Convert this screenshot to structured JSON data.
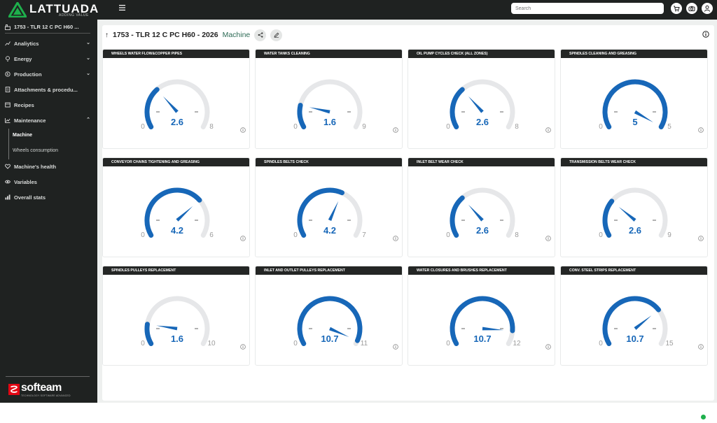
{
  "brand": {
    "name": "LATTUADA",
    "tagline": "ADDING VALUE",
    "accent_color": "#1eb04c"
  },
  "topbar": {
    "menu_icon": "hamburger-icon",
    "search_placeholder": "Search",
    "buttons": [
      {
        "name": "cart-icon"
      },
      {
        "name": "camera-icon"
      },
      {
        "name": "user-icon"
      }
    ]
  },
  "sidebar": {
    "machine": "1753 - TLR 12 C PC H60 ...",
    "items": [
      {
        "label": "Analiytics",
        "icon": "chart-icon",
        "chevron": "down"
      },
      {
        "label": "Energy",
        "icon": "bulb-icon",
        "chevron": "down"
      },
      {
        "label": "Production",
        "icon": "production-icon",
        "chevron": "down"
      },
      {
        "label": "Attachments & procedu...",
        "icon": "document-icon",
        "chevron": ""
      },
      {
        "label": "Recipes",
        "icon": "recipes-icon",
        "chevron": ""
      },
      {
        "label": "Maintenance",
        "icon": "maintenance-icon",
        "chevron": "up"
      },
      {
        "label": "Machine's health",
        "icon": "heart-icon",
        "chevron": ""
      },
      {
        "label": "Variables",
        "icon": "eye-icon",
        "chevron": ""
      },
      {
        "label": "Overall stats",
        "icon": "stats-icon",
        "chevron": ""
      }
    ],
    "sub_items": [
      {
        "label": "Machine",
        "active": true
      },
      {
        "label": "Wheels consumption",
        "active": false
      }
    ],
    "footer": {
      "name": "softeam",
      "tagline": "TECHNOLOGY SOFTWARE ADVANCED"
    }
  },
  "header": {
    "title": "1753 - TLR 12 C PC H60 - 2026",
    "subtitle": "Machine"
  },
  "gauge_color": "#1767b8",
  "gauges": [
    {
      "title": "WHEELS WATER FLOW&COPPER PIPES",
      "value": 2.6,
      "value_label": "2.6",
      "min_label": "0",
      "max": 8,
      "max_label": "8"
    },
    {
      "title": "WATER TANKS CLEANING",
      "value": 1.6,
      "value_label": "1.6",
      "min_label": "0",
      "max": 9,
      "max_label": "9"
    },
    {
      "title": "OIL PUMP CYCLES CHECK (ALL ZONES)",
      "value": 2.6,
      "value_label": "2.6",
      "min_label": "0",
      "max": 8,
      "max_label": "8"
    },
    {
      "title": "SPINDLES CLEANING AND GREASING",
      "value": 5,
      "value_label": "5",
      "min_label": "0",
      "max": 5,
      "max_label": "5"
    },
    {
      "title": "CONVEYOR CHAINS TIGHTENING AND GREASING",
      "value": 4.2,
      "value_label": "4.2",
      "min_label": "0",
      "max": 6,
      "max_label": "6"
    },
    {
      "title": "SPINDLES BELTS CHECK",
      "value": 4.2,
      "value_label": "4.2",
      "min_label": "0",
      "max": 7,
      "max_label": "7"
    },
    {
      "title": "INLET BELT WEAR CHECK",
      "value": 2.6,
      "value_label": "2.6",
      "min_label": "0",
      "max": 8,
      "max_label": "8"
    },
    {
      "title": "TRANSMISSION BELTS WEAR CHECK",
      "value": 2.6,
      "value_label": "2.6",
      "min_label": "0",
      "max": 9,
      "max_label": "9"
    },
    {
      "title": "SPINDLES PULLEYS REPLACEMENT",
      "value": 1.6,
      "value_label": "1.6",
      "min_label": "0",
      "max": 10,
      "max_label": "10"
    },
    {
      "title": "INLET AND OUTLET PULLEYS REPLACEMENT",
      "value": 10.7,
      "value_label": "10.7",
      "min_label": "0",
      "max": 11,
      "max_label": "11"
    },
    {
      "title": "WATER CLOSURES AND BRUSHES REPLACEMENT",
      "value": 10.7,
      "value_label": "10.7",
      "min_label": "0",
      "max": 12,
      "max_label": "12"
    },
    {
      "title": "CONV. STEEL STRIPS REPLACEMENT",
      "value": 10.7,
      "value_label": "10.7",
      "min_label": "0",
      "max": 15,
      "max_label": "15"
    }
  ]
}
